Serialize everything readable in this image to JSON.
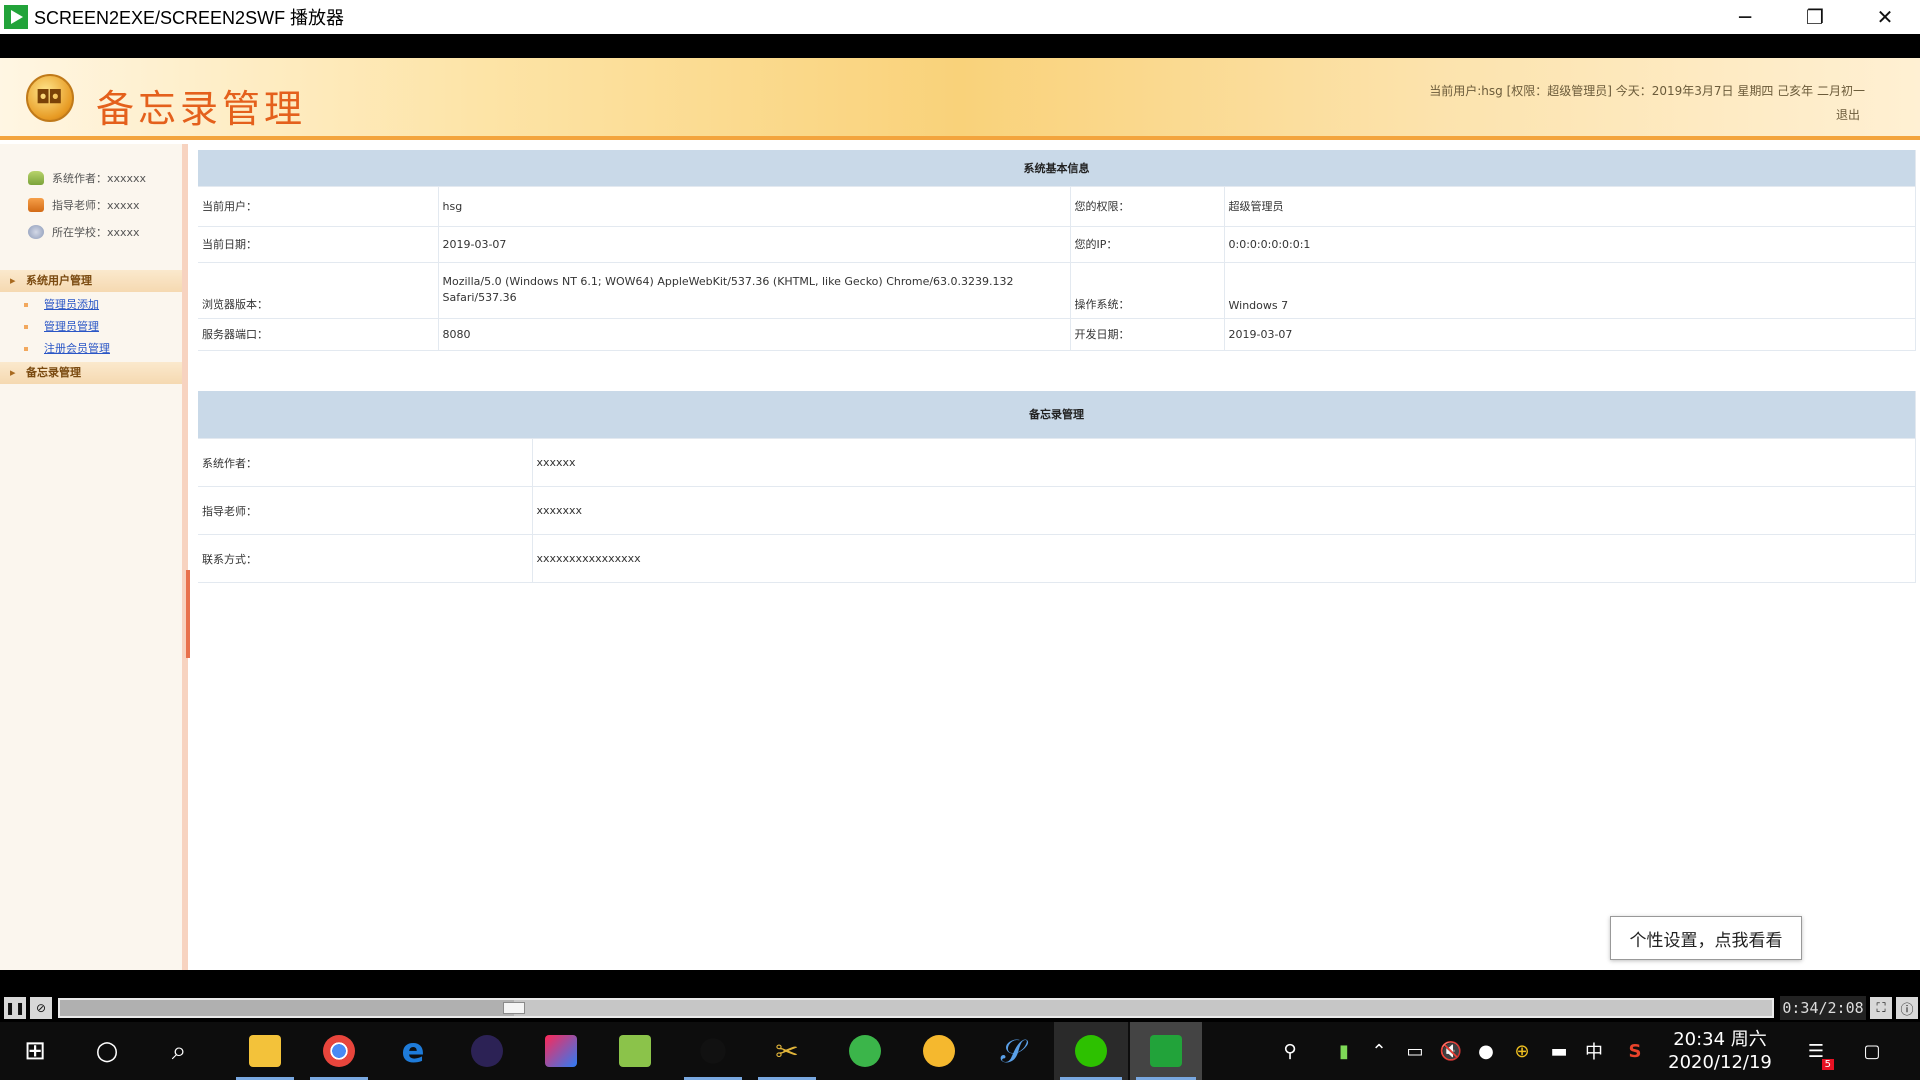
{
  "window": {
    "title": "SCREEN2EXE/SCREEN2SWF 播放器",
    "minimize": "─",
    "restore": "❐",
    "close": "✕"
  },
  "header": {
    "logo_text": "备忘录管理",
    "user_info": "当前用户:hsg [权限：超级管理员] 今天：2019年3月7日 星期四 己亥年 二月初一",
    "logout": "退出"
  },
  "sidebar": {
    "info": [
      {
        "label": "系统作者：xxxxxx"
      },
      {
        "label": "指导老师：xxxxx"
      },
      {
        "label": "所在学校：xxxxx"
      }
    ],
    "menu_user": "系统用户管理",
    "menu_user_items": [
      "管理员添加",
      "管理员管理",
      "注册会员管理"
    ],
    "menu_memo": "备忘录管理"
  },
  "system_info": {
    "section_title": "系统基本信息",
    "rows": [
      {
        "l1": "当前用户：",
        "v1": "hsg",
        "l2": "您的权限：",
        "v2": "超级管理员"
      },
      {
        "l1": "当前日期：",
        "v1": "2019-03-07",
        "l2": "您的IP：",
        "v2": "0:0:0:0:0:0:0:1"
      },
      {
        "l1": "浏览器版本：",
        "v1": "Mozilla/5.0 (Windows NT 6.1; WOW64) AppleWebKit/537.36 (KHTML, like Gecko) Chrome/63.0.3239.132 Safari/537.36",
        "l2": "操作系统：",
        "v2": "Windows 7"
      },
      {
        "l1": "服务器端口：",
        "v1": "8080",
        "l2": "开发日期：",
        "v2": "2019-03-07"
      }
    ]
  },
  "memo_info": {
    "section_title": "备忘录管理",
    "rows": [
      {
        "label": "系统作者：",
        "value": "xxxxxx"
      },
      {
        "label": "指导老师：",
        "value": "xxxxxxx"
      },
      {
        "label": "联系方式：",
        "value": "xxxxxxxxxxxxxxxx"
      }
    ]
  },
  "ime": {
    "tip": "个性设置，点我看看",
    "logo": "S",
    "mode": "中",
    "punct": "°,",
    "emoji": "☺",
    "voice": "🎤",
    "keyboard": "⌨",
    "tools": "⚙",
    "skin": "👕",
    "menu": "▦"
  },
  "player": {
    "time": "0:34/2:08",
    "progress_fraction": 0.265,
    "pause": "❚❚",
    "stop": "⊘",
    "fit": "⛶",
    "info": "ⓘ"
  },
  "taskbar": {
    "clock_time": "20:34 周六",
    "clock_date": "2020/12/19",
    "lang": "中",
    "notif_count": "5"
  }
}
